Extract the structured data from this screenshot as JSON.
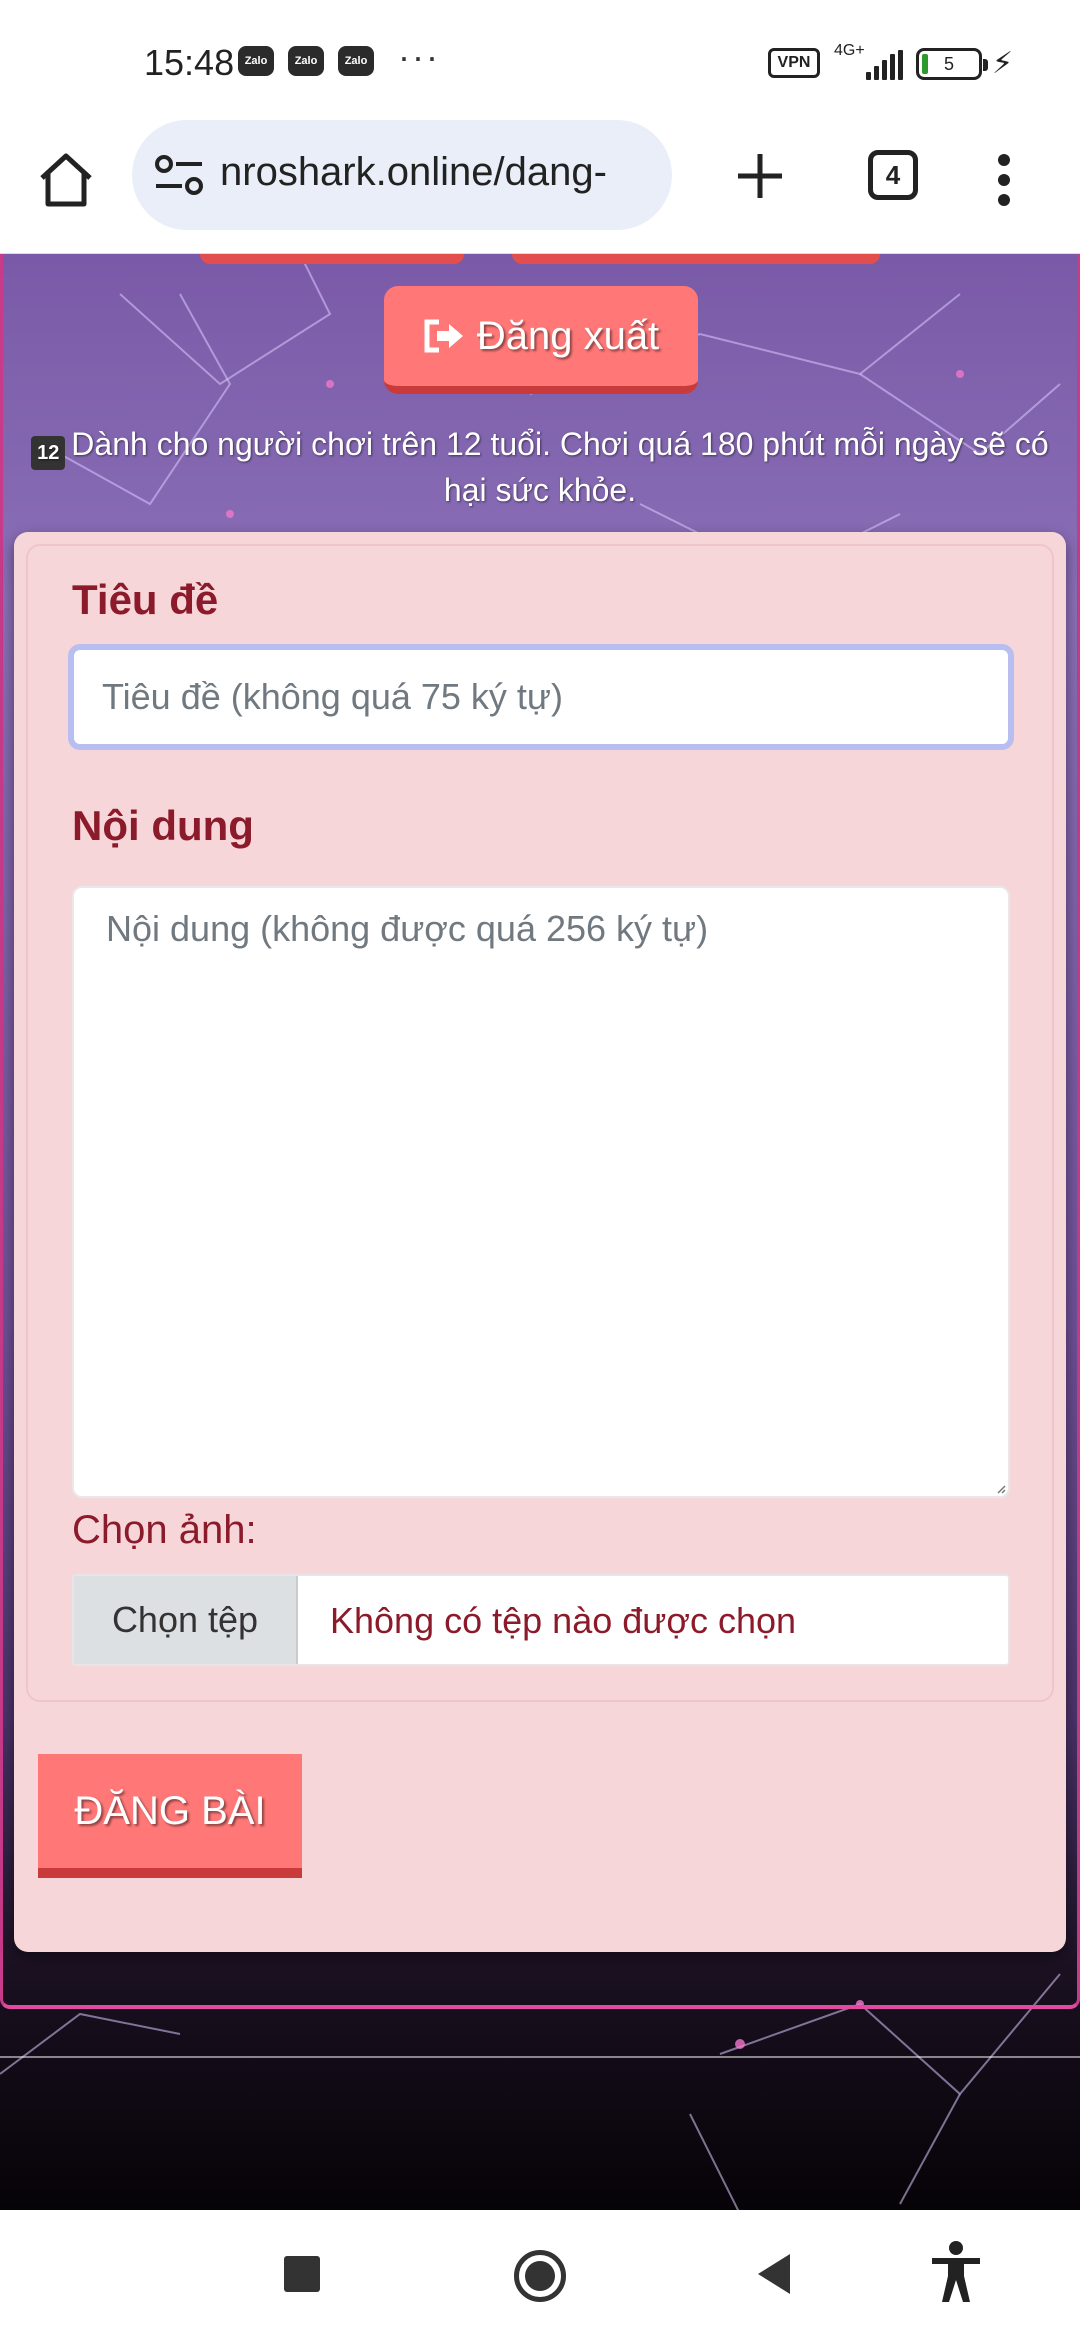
{
  "status_bar": {
    "time": "15:48",
    "notifications": [
      "Zalo",
      "Zalo",
      "Zalo"
    ],
    "more": "···",
    "vpn": "VPN",
    "network": "4G+",
    "battery": "5"
  },
  "browser": {
    "url": "nroshark.online/dang-",
    "tab_count": "4"
  },
  "page": {
    "logout_label": "Đăng xuất",
    "age_badge": "12",
    "age_warning": "Dành cho người chơi trên 12 tuổi. Chơi quá 180 phút mỗi ngày sẽ có hại sức khỏe."
  },
  "form": {
    "title_label": "Tiêu đề",
    "title_placeholder": "Tiêu đề (không quá 75 ký tự)",
    "content_label": "Nội dung",
    "content_placeholder": "Nội dung (không được quá 256 ký tự)",
    "image_label": "Chọn ảnh:",
    "file_button": "Chọn tệp",
    "file_status": "Không có tệp nào được chọn",
    "submit_label": "ĐĂNG BÀI"
  },
  "colors": {
    "accent": "#ff7777",
    "label": "#8b1a2a",
    "card": "#f7d6da"
  }
}
